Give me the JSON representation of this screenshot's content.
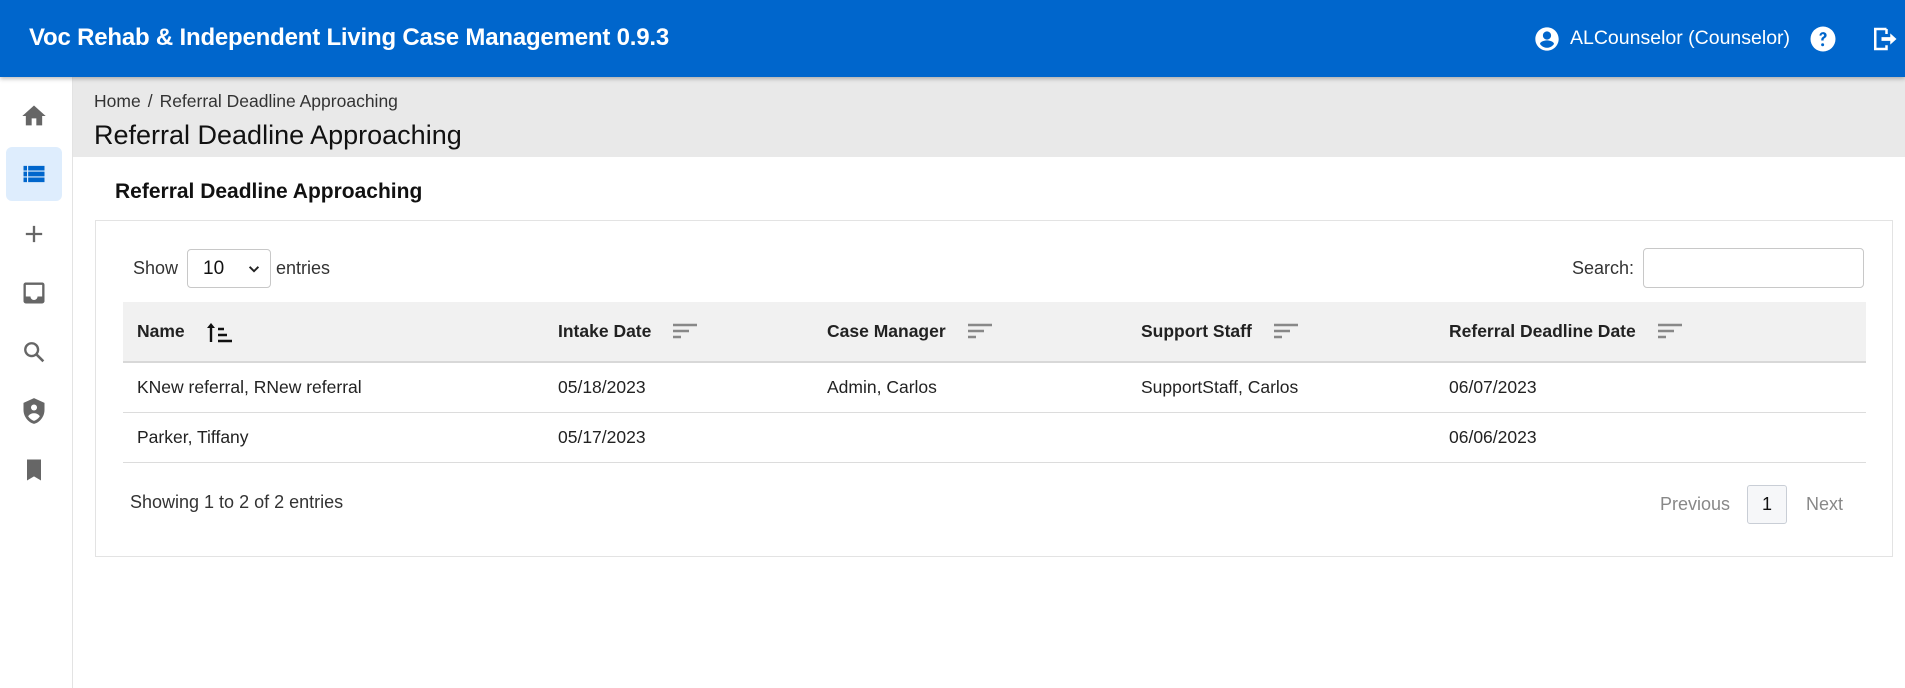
{
  "app": {
    "title": "Voc Rehab & Independent Living Case Management 0.9.3",
    "brand_color": "#0066cc"
  },
  "user": {
    "label": "ALCounselor (Counselor)",
    "icon": "account-circle-icon"
  },
  "header_actions": {
    "help_icon": "help-circle-icon",
    "logout_icon": "logout-icon"
  },
  "sidebar": {
    "items": [
      {
        "name": "home",
        "icon": "home-icon",
        "active": false
      },
      {
        "name": "lists",
        "icon": "list-icon",
        "active": true
      },
      {
        "name": "add",
        "icon": "plus-icon",
        "active": false
      },
      {
        "name": "inbox",
        "icon": "inbox-icon",
        "active": false
      },
      {
        "name": "search",
        "icon": "search-icon",
        "active": false
      },
      {
        "name": "admin",
        "icon": "shield-user-icon",
        "active": false
      },
      {
        "name": "bookmarks",
        "icon": "bookmark-icon",
        "active": false
      }
    ]
  },
  "breadcrumb": {
    "home": "Home",
    "separator": "/",
    "current": "Referral Deadline Approaching"
  },
  "page": {
    "title": "Referral Deadline Approaching",
    "section_title": "Referral Deadline Approaching"
  },
  "table_controls": {
    "show_label": "Show",
    "entries_label": "entries",
    "page_length": "10",
    "search_label": "Search:",
    "search_value": "",
    "search_placeholder": ""
  },
  "table": {
    "columns": [
      {
        "label": "Name",
        "sort": "ascending"
      },
      {
        "label": "Intake Date",
        "sort": "none"
      },
      {
        "label": "Case Manager",
        "sort": "none"
      },
      {
        "label": "Support Staff",
        "sort": "none"
      },
      {
        "label": "Referral Deadline Date",
        "sort": "none"
      }
    ],
    "rows": [
      [
        "KNew referral, RNew referral",
        "05/18/2023",
        "Admin, Carlos",
        "SupportStaff, Carlos",
        "06/07/2023"
      ],
      [
        "Parker, Tiffany",
        "05/17/2023",
        "",
        "",
        "06/06/2023"
      ]
    ]
  },
  "footer": {
    "info": "Showing 1 to 2 of 2 entries",
    "previous": "Previous",
    "current_page": "1",
    "next": "Next"
  }
}
